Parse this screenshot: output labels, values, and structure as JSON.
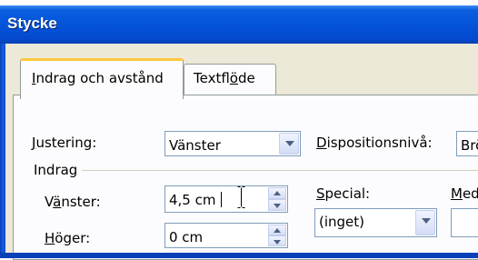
{
  "window": {
    "title": "Stycke"
  },
  "tabs": [
    {
      "label_pre": "",
      "label_key": "I",
      "label_post": "ndrag och avstånd",
      "active": true
    },
    {
      "label_pre": "Textfl",
      "label_key": "ö",
      "label_post": "de",
      "active": false
    }
  ],
  "alignment": {
    "label_pre": "",
    "label_key": "J",
    "label_post": "ustering:",
    "value": "Vänster"
  },
  "outline_level": {
    "label_pre": "",
    "label_key": "D",
    "label_post": "ispositionsnivå:",
    "value": "Brö"
  },
  "indent_group": {
    "label": "Indrag"
  },
  "indent_left": {
    "label_pre": "V",
    "label_key": "ä",
    "label_post": "nster:",
    "value": "4,5 cm"
  },
  "indent_right": {
    "label_pre": "",
    "label_key": "H",
    "label_post": "öger:",
    "value": "0 cm"
  },
  "special": {
    "label_pre": "",
    "label_key": "S",
    "label_post": "pecial:",
    "value": "(inget)"
  },
  "by": {
    "label_pre": "",
    "label_key": "M",
    "label_post": "ed"
  },
  "icons": {
    "dropdown": "chevron-down-icon",
    "spin": "spin-up-down-icon",
    "cursor": "ibeam-cursor-icon"
  },
  "colors": {
    "titlebar": "#0554d9",
    "dialog_bg": "#ece9d8",
    "tab_highlight": "#ffc83c",
    "field_border": "#7f9db9"
  }
}
